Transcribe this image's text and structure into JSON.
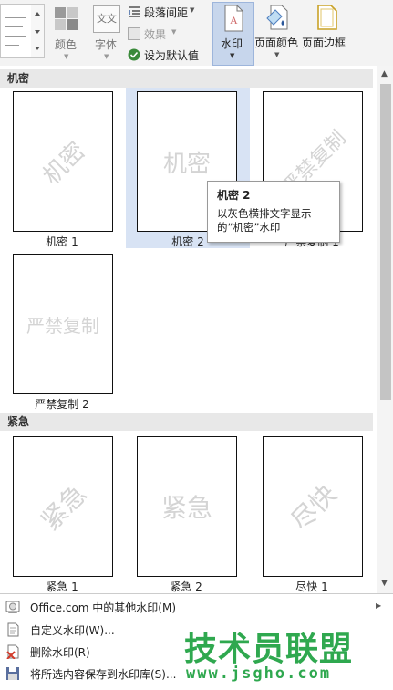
{
  "ribbon": {
    "color_label": "颜色",
    "font_label": "字体",
    "font_icon_text": "文文",
    "paragraph_spacing": "段落间距",
    "effects": "效果",
    "set_default": "设为默认值",
    "watermark": "水印",
    "page_color": "页面颜色",
    "page_border": "页面边框"
  },
  "gallery": {
    "sections": [
      {
        "title": "机密"
      },
      {
        "title": "紧急"
      }
    ],
    "items": [
      {
        "caption": "机密 1",
        "watermark": "机密"
      },
      {
        "caption": "机密 2",
        "watermark": "机密"
      },
      {
        "caption": "严禁复制 1",
        "watermark": "严禁复制"
      },
      {
        "caption": "严禁复制 2",
        "watermark": "严禁复制"
      },
      {
        "caption": "紧急 1",
        "watermark": "紧急"
      },
      {
        "caption": "紧急 2",
        "watermark": "紧急"
      },
      {
        "caption": "尽快 1",
        "watermark": "尽快"
      }
    ]
  },
  "tooltip": {
    "title": "机密 2",
    "description": "以灰色横排文字显示的“机密”水印"
  },
  "menu": {
    "items": [
      {
        "label": "Office.com 中的其他水印(M)",
        "icon": "office-icon"
      },
      {
        "label": "自定义水印(W)...",
        "icon": "custom-watermark-icon"
      },
      {
        "label": "删除水印(R)",
        "icon": "remove-watermark-icon"
      },
      {
        "label": "将所选内容保存到水印库(S)...",
        "icon": "save-icon"
      }
    ]
  },
  "brand": {
    "name": "技术员联盟",
    "url": "www.jsgho.com"
  },
  "colors": {
    "accent": "#2b579a",
    "selected_bg": "#d8e3f4",
    "watermark_gray": "#d4d4d4",
    "section_bg": "#e8e8e8",
    "brand_green": "#2fa84f"
  }
}
